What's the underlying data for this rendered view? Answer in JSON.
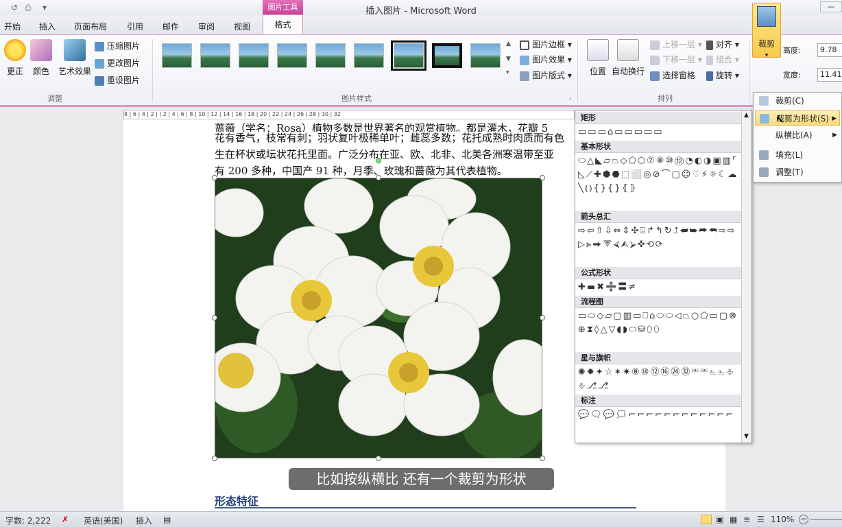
{
  "window": {
    "title": "插入图片 - Microsoft Word",
    "context_tab": "图片工具"
  },
  "tabs": [
    "开始",
    "插入",
    "页面布局",
    "引用",
    "邮件",
    "审阅",
    "视图"
  ],
  "active_tab": "格式",
  "ribbon": {
    "adjust": {
      "label": "调整",
      "buttons": [
        "更正",
        "颜色",
        "艺术效果"
      ],
      "small": [
        "压缩图片",
        "更改图片",
        "重设图片"
      ]
    },
    "styles": {
      "label": "图片样式",
      "small": [
        "图片边框",
        "图片效果",
        "图片版式"
      ]
    },
    "arrange": {
      "label": "排列",
      "big": [
        "位置",
        "自动换行"
      ],
      "small": [
        "上移一层",
        "下移一层",
        "选择窗格",
        "对齐",
        "组合",
        "旋转"
      ]
    },
    "crop": {
      "label": "裁剪"
    },
    "size": {
      "height_label": "高度:",
      "height_value": "9.78",
      "width_label": "宽度:",
      "width_value": "11.41"
    }
  },
  "ruler": "8 | 6 | 4 | 2 |   | 2 | 4 | 6 | 8 | 10 | 12 | 14 | 16 | 18 | 20 | 22 | 24 | 26 | 28 | 30 | 32",
  "document": {
    "lines": [
      "蔷薇（学名：Rosa）植物多数是世界著名的观赏植物。都是灌木，花瓣 5",
      "花有香气，枝常有刺；羽状复叶极稀单叶；雌蕊多数；花托成熟时肉质而有色",
      "生在杯状或坛状花托里面。广泛分布在亚、欧、北非、北美各洲寒温带至亚",
      "有 200 多种，中国产 91 种，月季、玫瑰和蔷薇为其代表植物。"
    ],
    "heading": "形态特征"
  },
  "subtitle": "比如按纵横比  还有一个裁剪为形状",
  "shape_panel": {
    "categories": [
      {
        "name": "矩形",
        "shapes": "▭▭▭⌂▭▭▭▭▭"
      },
      {
        "name": "基本形状",
        "shapes": "⬭△◣▱⏢◇⬠⬡⑦⑧⑩⑫◔◐◑▣▥⌜◺⟋✚⬢⬣⬚⬜◎⊘⌒▢☺♡⚡☼☾☁╲⦅⦆{}{}⦃⦄"
      },
      {
        "name": "箭头总汇",
        "shapes": "⇨⇦⇧⇩⇔⇕✣⍗↱↰↻⮥⮨⮩⮫⮪⇨⇨▷⪢⮕⮗⮘⮙⮚✜⟲⟳"
      },
      {
        "name": "公式形状",
        "shapes": "✚▬✖➗〓≠"
      },
      {
        "name": "流程图",
        "shapes": "▭⬭◇▱▢▥▭⎕⌂⬭⬭◁⏢○⬠▭▢⊗⊕⧗◊△▽◖◗⬭⛁⬯⬯"
      },
      {
        "name": "星与旗帜",
        "shapes": "✺✹✦☆✶✷⑧⑩⑫⑯㉔㉜⎃⎃⎁⎁⎀⎀⎇⎇"
      },
      {
        "name": "标注",
        "shapes": "💬🗨💬🗯⌐⌐⌐⌐⌐⌐⌐⌐⌐⌐⌐⌐"
      }
    ]
  },
  "crop_menu": {
    "items": [
      {
        "label": "裁剪(C)",
        "submenu": false
      },
      {
        "label": "裁剪为形状(S)",
        "submenu": true
      },
      {
        "label": "纵横比(A)",
        "submenu": true
      },
      {
        "label": "填充(L)",
        "submenu": false
      },
      {
        "label": "调整(T)",
        "submenu": false
      }
    ]
  },
  "status": {
    "words": "字数: 2,222",
    "lang": "英语(美国)",
    "mode": "插入",
    "zoom": "110%"
  },
  "colors": {
    "accent": "#c8449a",
    "highlight": "#f8c94c",
    "heading": "#1f3f7a"
  }
}
